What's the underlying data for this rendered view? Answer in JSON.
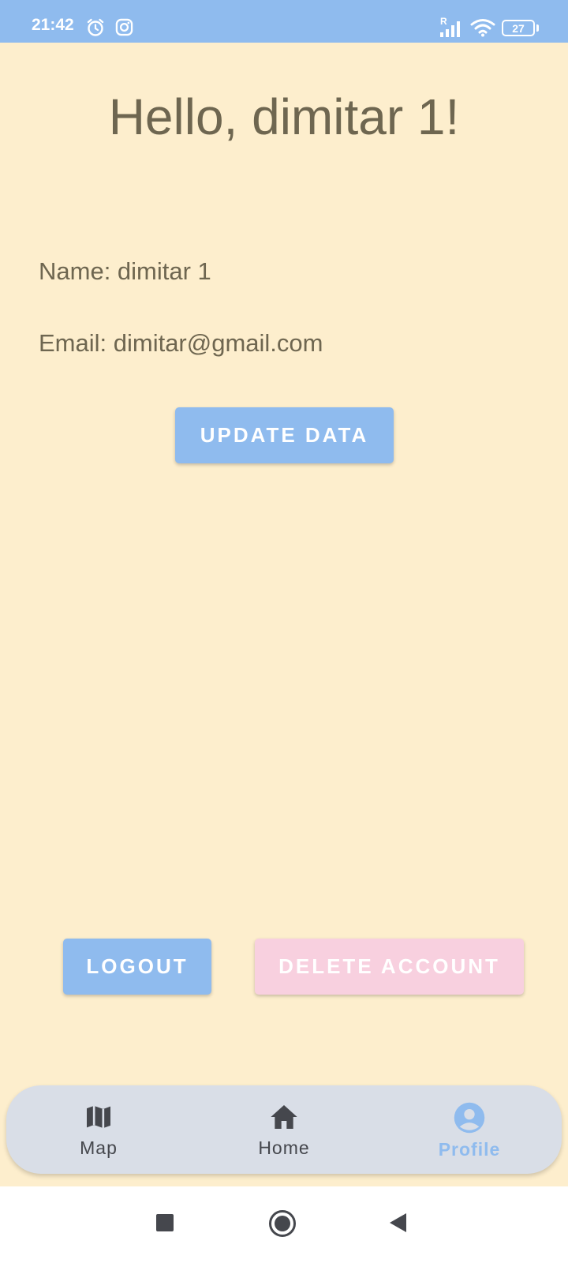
{
  "status_bar": {
    "time": "21:42",
    "battery": "27",
    "signal_label": "R",
    "icons": [
      "alarm-icon",
      "instagram-icon",
      "signal-icon",
      "wifi-icon",
      "battery-icon"
    ]
  },
  "profile": {
    "greeting": "Hello, dimitar 1!",
    "name_line": "Name: dimitar 1",
    "email_line": "Email: dimitar@gmail.com",
    "update_button": "UPDATE DATA",
    "logout_button": "LOGOUT",
    "delete_button": "DELETE ACCOUNT"
  },
  "bottom_nav": {
    "items": [
      {
        "label": "Map",
        "icon": "map-icon",
        "active": false
      },
      {
        "label": "Home",
        "icon": "home-icon",
        "active": false
      },
      {
        "label": "Profile",
        "icon": "profile-icon",
        "active": true
      }
    ]
  },
  "system_nav": {
    "buttons": [
      "recents-button",
      "home-button",
      "back-button"
    ]
  },
  "colors": {
    "background": "#FDEECD",
    "accent_blue": "#8FBBEE",
    "danger_pink": "#F8D0DF",
    "text": "#6E6650",
    "nav_background": "#D9DEE7"
  }
}
